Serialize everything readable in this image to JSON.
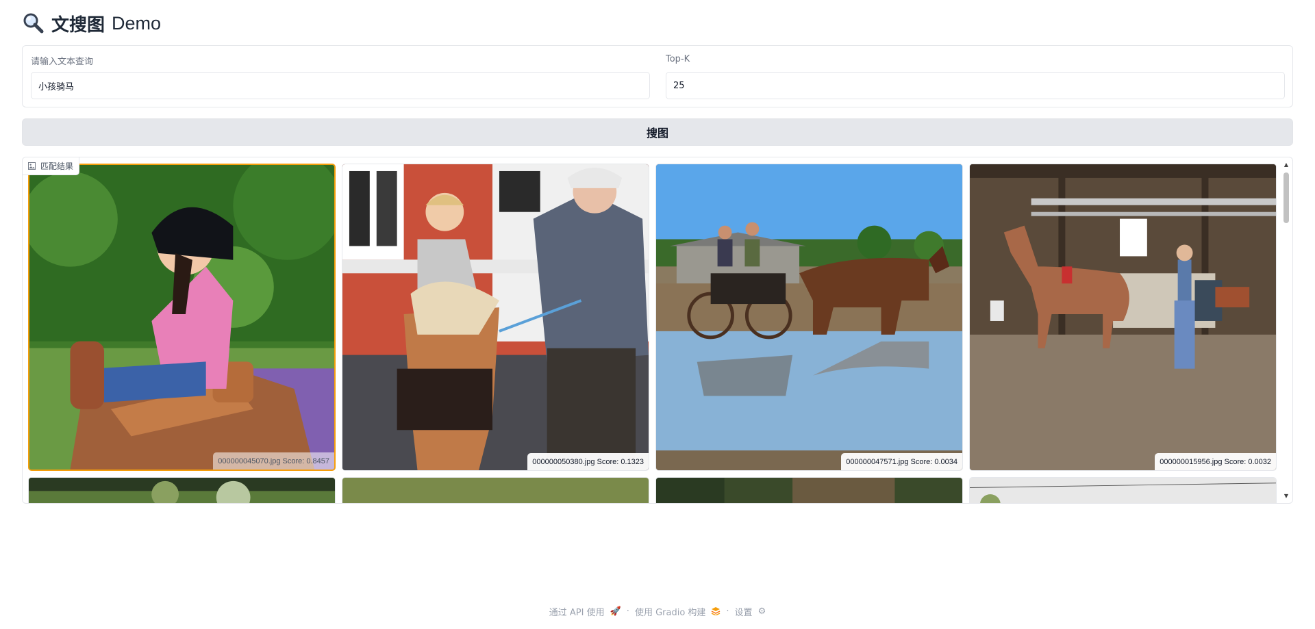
{
  "header": {
    "title_cn": "文搜图",
    "title_en": "Demo",
    "icon": "magnifier-icon"
  },
  "query_field": {
    "label": "请输入文本查询",
    "value": "小孩骑马"
  },
  "topk_field": {
    "label": "Top-K",
    "value": "25"
  },
  "search_button": {
    "label": "搜图"
  },
  "gallery": {
    "label": "匹配结果",
    "items": [
      {
        "caption": "000000045070.jpg Score: 0.8457"
      },
      {
        "caption": "000000050380.jpg Score: 0.1323"
      },
      {
        "caption": "000000047571.jpg Score: 0.0034"
      },
      {
        "caption": "000000015956.jpg Score: 0.0032"
      }
    ]
  },
  "footer": {
    "api": "通过 API 使用",
    "built": "使用 Gradio 构建",
    "settings": "设置",
    "separator": "·"
  },
  "colors": {
    "accent_border": "#f59e0b",
    "button_bg": "#e5e7eb",
    "border": "#e5e7eb"
  }
}
